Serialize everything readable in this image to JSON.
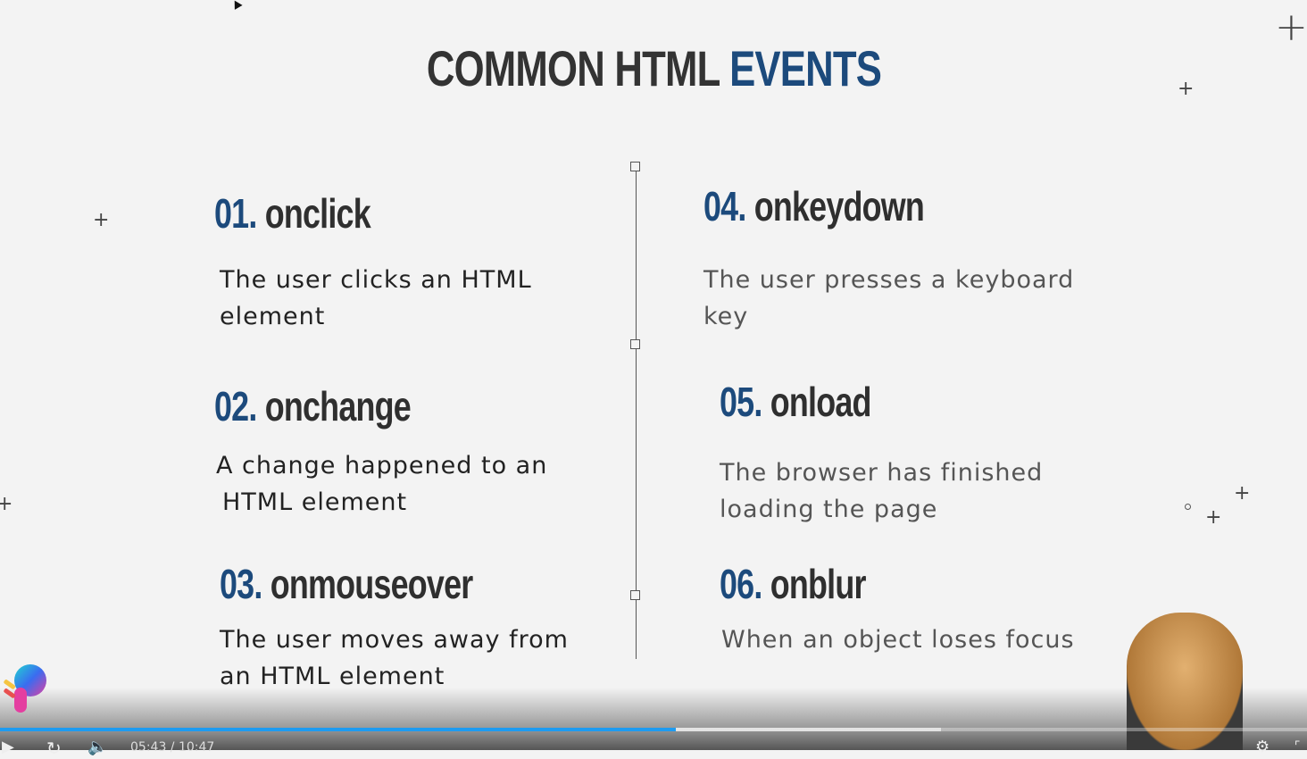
{
  "slide": {
    "title_part1": "COMMON HTML",
    "title_part2": "EVENTS",
    "events": [
      {
        "num": "01.",
        "name": "onclick",
        "desc1": "The user clicks an HTML",
        "desc2": "element"
      },
      {
        "num": "02.",
        "name": "onchange",
        "desc1": "A change happened to an",
        "desc2": "HTML element"
      },
      {
        "num": "03.",
        "name": "onmouseover",
        "desc1": "The user moves away from",
        "desc2": "an HTML element"
      },
      {
        "num": "04.",
        "name": "onkeydown",
        "desc1": "The user presses a keyboard",
        "desc2": "key"
      },
      {
        "num": "05.",
        "name": "onload",
        "desc1": "The browser has finished",
        "desc2": "loading the page"
      },
      {
        "num": "06.",
        "name": "onblur",
        "desc1": "When an object loses focus",
        "desc2": ""
      }
    ]
  },
  "player": {
    "time": "05:43 / 10:47",
    "progress_percent": 51.7,
    "buffered_percent": 72,
    "accent": "#1e9bf0"
  }
}
